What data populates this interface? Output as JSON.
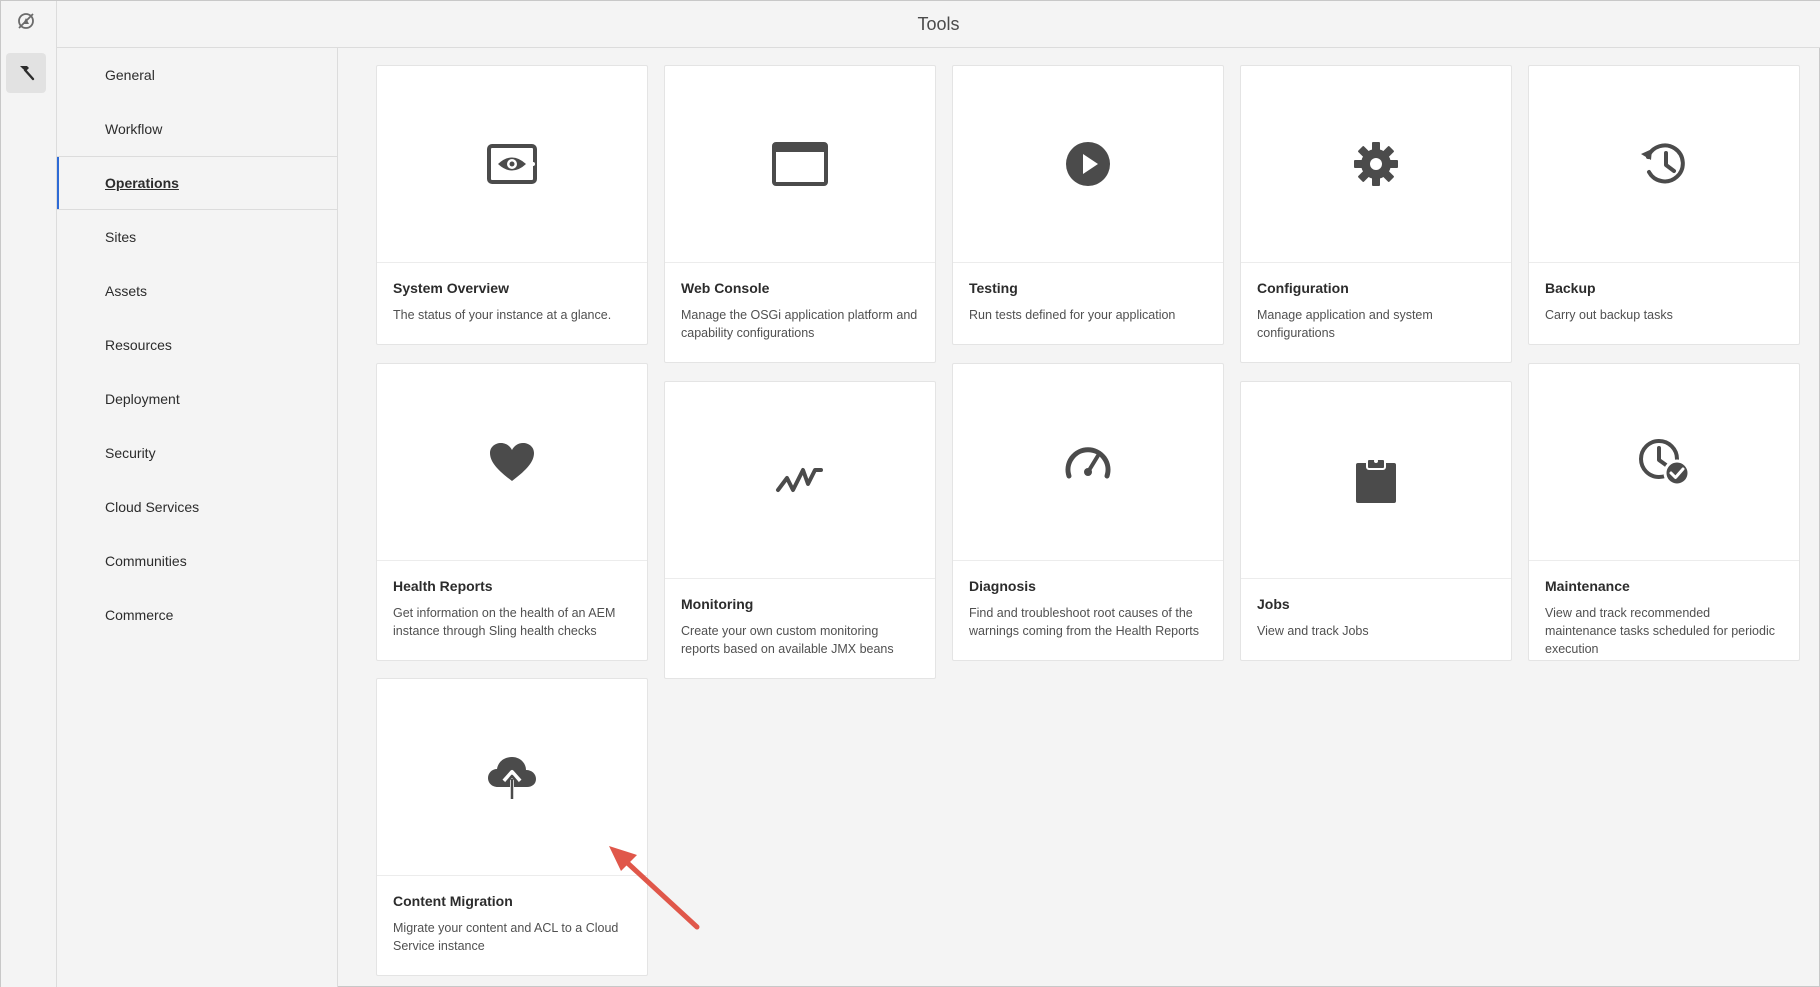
{
  "header": {
    "title": "Tools"
  },
  "rail": {
    "logo_icon": "adobe-logo-icon",
    "tools_icon": "hammer-icon"
  },
  "sidenav": {
    "items": [
      {
        "label": "General"
      },
      {
        "label": "Workflow"
      },
      {
        "label": "Operations",
        "active": true
      },
      {
        "label": "Sites"
      },
      {
        "label": "Assets"
      },
      {
        "label": "Resources"
      },
      {
        "label": "Deployment"
      },
      {
        "label": "Security"
      },
      {
        "label": "Cloud Services"
      },
      {
        "label": "Communities"
      },
      {
        "label": "Commerce"
      }
    ]
  },
  "cards": [
    {
      "title": "System Overview",
      "desc": "The status of your instance at a glance.",
      "icon": "eye-monitor-icon"
    },
    {
      "title": "Web Console",
      "desc": "Manage the OSGi application platform and capability configurations",
      "icon": "window-icon"
    },
    {
      "title": "Testing",
      "desc": "Run tests defined for your application",
      "icon": "play-circle-icon"
    },
    {
      "title": "Configuration",
      "desc": "Manage application and system configurations",
      "icon": "gear-icon"
    },
    {
      "title": "Backup",
      "desc": "Carry out backup tasks",
      "icon": "history-icon"
    },
    {
      "title": "Health Reports",
      "desc": "Get information on the health of an AEM instance through Sling health checks",
      "icon": "heart-icon"
    },
    {
      "title": "Monitoring",
      "desc": "Create your own custom monitoring reports based on available JMX beans",
      "icon": "pulse-icon"
    },
    {
      "title": "Diagnosis",
      "desc": "Find and troubleshoot root causes of the warnings coming from the Health Reports",
      "icon": "gauge-icon"
    },
    {
      "title": "Jobs",
      "desc": "View and track Jobs",
      "icon": "clipboard-icon"
    },
    {
      "title": "Maintenance",
      "desc": "View and track recommended maintenance tasks scheduled for periodic execution",
      "icon": "clock-check-icon"
    },
    {
      "title": "Content Migration",
      "desc": "Migrate your content and ACL to a Cloud Service instance",
      "icon": "cloud-upload-icon"
    }
  ],
  "colors": {
    "accent": "#2d6ad6",
    "icon": "#4b4b4b",
    "annotation_arrow": "#e0574a"
  }
}
